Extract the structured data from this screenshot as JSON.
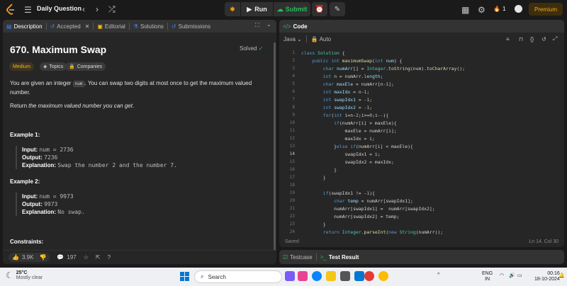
{
  "header": {
    "title": "Daily Question",
    "run_label": "Run",
    "submit_label": "Submit",
    "streak": "1",
    "premium_label": "Premium"
  },
  "left_tabs": [
    {
      "label": "Description"
    },
    {
      "label": "Accepted"
    },
    {
      "label": "Editorial"
    },
    {
      "label": "Solutions"
    },
    {
      "label": "Submissions"
    }
  ],
  "problem": {
    "title": "670. Maximum Swap",
    "status": "Solved",
    "difficulty": "Medium",
    "topics_label": "Topics",
    "companies_label": "Companies",
    "desc_pre": "You are given an integer ",
    "desc_code": "num",
    "desc_post": ". You can swap two digits at most once to get the maximum valued number.",
    "return_pre": "Return ",
    "return_em": "the maximum valued number you can get",
    "return_post": ".",
    "ex1_title": "Example 1:",
    "ex1_input_label": "Input:",
    "ex1_input": "num = 2736",
    "ex1_output_label": "Output:",
    "ex1_output": "7236",
    "ex1_expl_label": "Explanation:",
    "ex1_expl": "Swap the number 2 and the number 7.",
    "ex2_title": "Example 2:",
    "ex2_input_label": "Input:",
    "ex2_input": "num = 9973",
    "ex2_output_label": "Output:",
    "ex2_output": "9973",
    "ex2_expl_label": "Explanation:",
    "ex2_expl": "No swap.",
    "constraints": "Constraints:"
  },
  "footer": {
    "likes": "3.9K",
    "comments": "197"
  },
  "code_panel": {
    "title": "Code",
    "language": "Java",
    "mode": "Auto",
    "saved": "Saved",
    "cursor": "Ln 14, Col 30",
    "line_numbers": [
      "1",
      "2",
      "3",
      "4",
      "5",
      "6",
      "7",
      "8",
      "9",
      "10",
      "11",
      "12",
      "13",
      "14",
      "15",
      "16",
      "17",
      "18",
      "19",
      "20",
      "21",
      "22",
      "23",
      "24"
    ]
  },
  "bottom_tabs": {
    "testcase": "Testcase",
    "result": "Test Result"
  },
  "taskbar": {
    "temp": "25°C",
    "weather": "Mostly clear",
    "search_placeholder": "Search",
    "lang": "ENG",
    "region": "IN",
    "time": "00:16",
    "date": "18-10-2024"
  }
}
